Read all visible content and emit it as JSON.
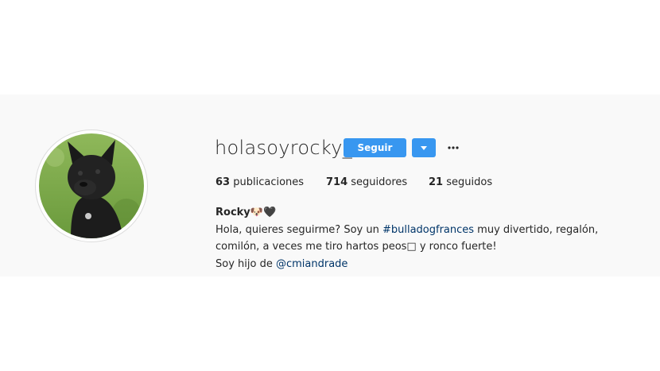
{
  "profile": {
    "username": "holasoyrocky_",
    "follow_label": "Seguir",
    "stats": {
      "posts_count": "63",
      "posts_label": "publicaciones",
      "followers_count": "714",
      "followers_label": "seguidores",
      "following_count": "21",
      "following_label": "seguidos"
    },
    "bio": {
      "name": "Rocky",
      "name_emoji": "🐶🖤",
      "line1_prefix": "Hola, quieres seguirme? Soy un ",
      "hashtag": "#bulladogfrances",
      "line1_suffix": " muy divertido, regalón, comilón, a veces me tiro hartos peos□ y ronco fuerte!",
      "line2_prefix": "Soy hijo de ",
      "mention": "@cmiandrade"
    }
  },
  "colors": {
    "accent": "#3897f0",
    "link": "#003569",
    "band_background": "#f9f9f9"
  },
  "icons": {
    "dropdown": "triangle-down-icon",
    "more": "more-options-icon"
  }
}
